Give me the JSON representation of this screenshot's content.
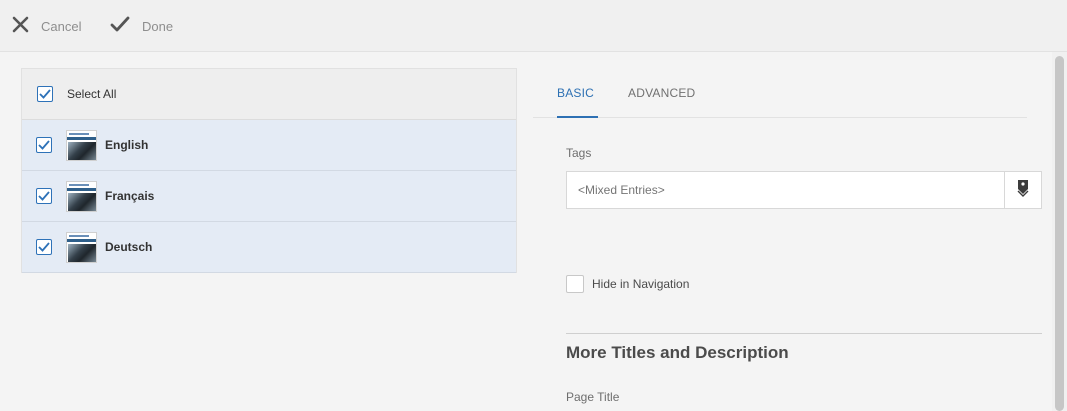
{
  "toolbar": {
    "cancel_label": "Cancel",
    "done_label": "Done"
  },
  "selection_list": {
    "select_all_label": "Select All",
    "select_all_checked": true,
    "items": [
      {
        "label": "English",
        "checked": true
      },
      {
        "label": "Français",
        "checked": true
      },
      {
        "label": "Deutsch",
        "checked": true
      }
    ]
  },
  "tabs": [
    {
      "label": "BASIC",
      "active": true
    },
    {
      "label": "ADVANCED",
      "active": false
    }
  ],
  "form": {
    "tags_label": "Tags",
    "tags_placeholder": "<Mixed Entries>",
    "hide_in_navigation_label": "Hide in Navigation",
    "hide_in_navigation_checked": false,
    "section_title": "More Titles and Description",
    "page_title_label": "Page Title"
  },
  "colors": {
    "accent": "#2d70b3",
    "selected_row": "#e4ebf5",
    "background": "#f4f4f4"
  }
}
